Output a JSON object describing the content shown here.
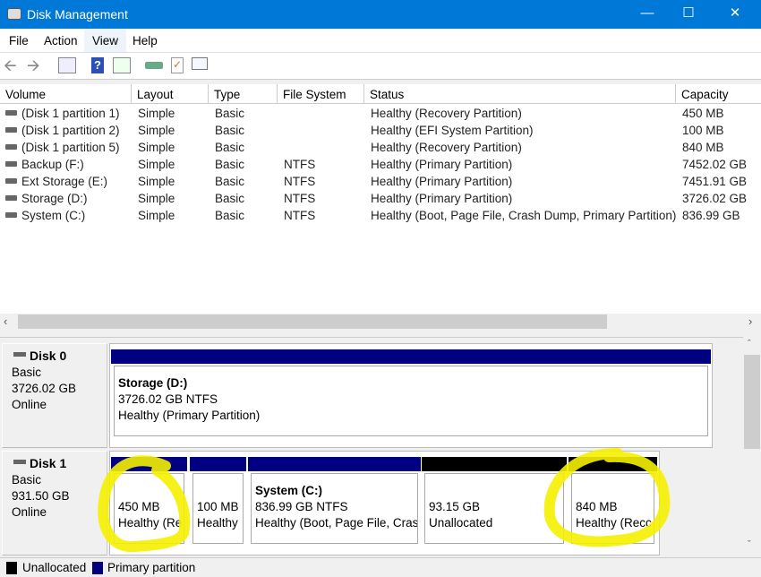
{
  "window": {
    "title": "Disk Management",
    "icon": "disk-management-icon"
  },
  "menu": [
    "File",
    "Action",
    "View",
    "Help"
  ],
  "toolbar": [
    "back-icon",
    "forward-icon",
    "console-tree-icon",
    "help-icon",
    "action-pane-icon",
    "connect-icon",
    "properties-icon",
    "list-icon"
  ],
  "table": {
    "columns": [
      "Volume",
      "Layout",
      "Type",
      "File System",
      "Status",
      "Capacity"
    ],
    "rows": [
      [
        "(Disk 1 partition 1)",
        "Simple",
        "Basic",
        "",
        "Healthy (Recovery Partition)",
        "450 MB"
      ],
      [
        "(Disk 1 partition 2)",
        "Simple",
        "Basic",
        "",
        "Healthy (EFI System Partition)",
        "100 MB"
      ],
      [
        "(Disk 1 partition 5)",
        "Simple",
        "Basic",
        "",
        "Healthy (Recovery Partition)",
        "840 MB"
      ],
      [
        "Backup (F:)",
        "Simple",
        "Basic",
        "NTFS",
        "Healthy (Primary Partition)",
        "7452.02 GB"
      ],
      [
        "Ext Storage (E:)",
        "Simple",
        "Basic",
        "NTFS",
        "Healthy (Primary Partition)",
        "7451.91 GB"
      ],
      [
        "Storage (D:)",
        "Simple",
        "Basic",
        "NTFS",
        "Healthy (Primary Partition)",
        "3726.02 GB"
      ],
      [
        "System (C:)",
        "Simple",
        "Basic",
        "NTFS",
        "Healthy (Boot, Page File, Crash Dump, Primary Partition)",
        "836.99 GB"
      ]
    ]
  },
  "disks": [
    {
      "name": "Disk 0",
      "type": "Basic",
      "size": "3726.02 GB",
      "status": "Online",
      "partitions": [
        {
          "title": "Storage  (D:)",
          "line1": "3726.02 GB NTFS",
          "line2": "Healthy (Primary Partition)",
          "color": "#000080"
        }
      ]
    },
    {
      "name": "Disk 1",
      "type": "Basic",
      "size": "931.50 GB",
      "status": "Online",
      "partitions": [
        {
          "title": "",
          "line1": "450 MB",
          "line2": "Healthy (Re",
          "color": "#000080"
        },
        {
          "title": "",
          "line1": "100 MB",
          "line2": "Healthy",
          "color": "#000080"
        },
        {
          "title": "System  (C:)",
          "line1": "836.99 GB NTFS",
          "line2": "Healthy (Boot, Page File, Crasl",
          "color": "#000080"
        },
        {
          "title": "",
          "line1": "93.15 GB",
          "line2": "Unallocated",
          "color": "#000000"
        },
        {
          "title": "",
          "line1": "840 MB",
          "line2": "Healthy (Recc",
          "color": "#000000"
        }
      ]
    }
  ],
  "legend": [
    {
      "label": "Unallocated",
      "color": "#000000"
    },
    {
      "label": "Primary partition",
      "color": "#000080"
    }
  ],
  "annotation_color": "#f5f000"
}
